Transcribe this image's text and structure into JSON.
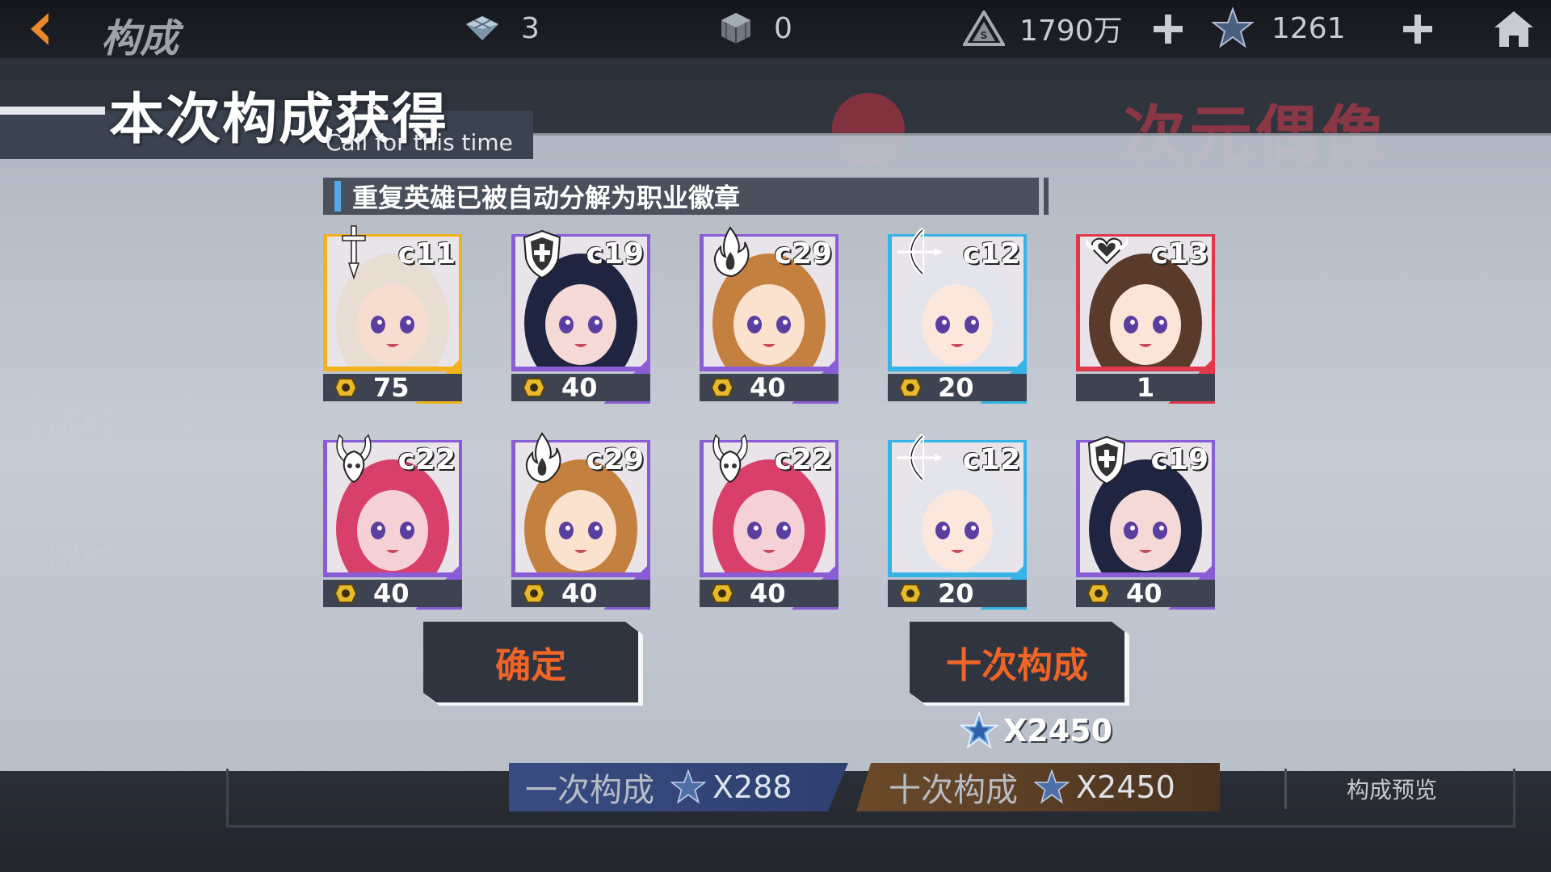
{
  "topbar": {
    "title": "构成",
    "resources": [
      {
        "icon": "crystal-cube-icon",
        "value": "3"
      },
      {
        "icon": "rubik-cube-icon",
        "value": "0"
      },
      {
        "icon": "triangle-coin-icon",
        "value": "1790万"
      },
      {
        "icon": "blue-star-icon",
        "value": "1261"
      }
    ]
  },
  "background": {
    "banner_title": "次元偶像",
    "side_label_1": "限时",
    "side_label_2": "限时",
    "once_button_label": "一次构成",
    "once_cost": "X288",
    "ten_button_label": "十次构成",
    "ten_cost": "X2450",
    "preview_label": "构成预览"
  },
  "modal": {
    "title": "本次构成获得",
    "subtitle": "Call for this time",
    "notice": "重复英雄已被自动分解为职业徽章",
    "results": [
      {
        "code": "c11",
        "class_icon": "sword-icon",
        "rarity_color": "#f3b21b",
        "hair": "#e8ddd2",
        "skin": "#f6ddd0",
        "reward": "75"
      },
      {
        "code": "c19",
        "class_icon": "shield-icon",
        "rarity_color": "#8a5dd6",
        "hair": "#1f2440",
        "skin": "#f4d9d6",
        "reward": "40"
      },
      {
        "code": "c29",
        "class_icon": "flame-icon",
        "rarity_color": "#8a5dd6",
        "hair": "#c4803f",
        "skin": "#fbe2cf",
        "reward": "40"
      },
      {
        "code": "c12",
        "class_icon": "bow-icon",
        "rarity_color": "#36b4e6",
        "hair": "#e4e4ec",
        "skin": "#fbe7dc",
        "reward": "20"
      },
      {
        "code": "c13",
        "class_icon": "heart-wing-icon",
        "rarity_color": "#e0384b",
        "hair": "#5a3a2a",
        "skin": "#fbe4d8",
        "reward": "1"
      },
      {
        "code": "c22",
        "class_icon": "horn-icon",
        "rarity_color": "#8a5dd6",
        "hair": "#d8406a",
        "skin": "#f5d1d6",
        "reward": "40"
      },
      {
        "code": "c29",
        "class_icon": "flame-icon",
        "rarity_color": "#8a5dd6",
        "hair": "#c4803f",
        "skin": "#fbe2cf",
        "reward": "40"
      },
      {
        "code": "c22",
        "class_icon": "horn-icon",
        "rarity_color": "#8a5dd6",
        "hair": "#d8406a",
        "skin": "#f5d1d6",
        "reward": "40"
      },
      {
        "code": "c12",
        "class_icon": "bow-icon",
        "rarity_color": "#36b4e6",
        "hair": "#e4e4ec",
        "skin": "#fbe7dc",
        "reward": "20"
      },
      {
        "code": "c19",
        "class_icon": "shield-icon",
        "rarity_color": "#8a5dd6",
        "hair": "#1f2440",
        "skin": "#f4d9d6",
        "reward": "40"
      }
    ],
    "confirm_label": "确定",
    "ten_call_label": "十次构成",
    "ten_call_cost": "X2450"
  },
  "colors": {
    "accent_orange": "#f06428",
    "notice_bar": "#53a8e8",
    "badge_gold": "#e8b92a"
  }
}
